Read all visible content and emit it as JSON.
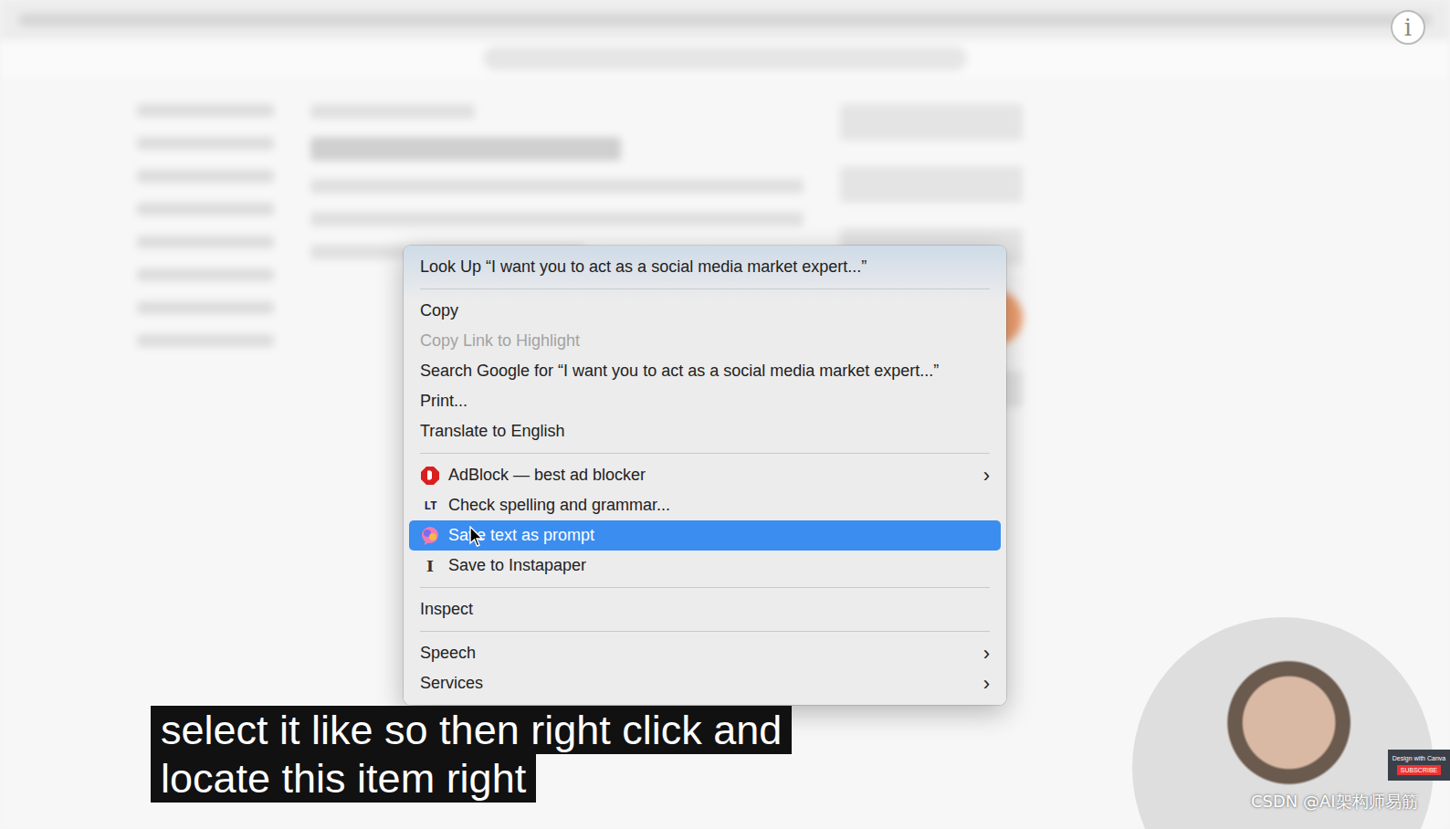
{
  "menu": {
    "groups": [
      [
        {
          "kind": "text",
          "label": "Look Up “I want you to act as a social media market expert...”",
          "selected": false,
          "disabled": false
        }
      ],
      [
        {
          "kind": "text",
          "label": "Copy",
          "selected": false,
          "disabled": false
        },
        {
          "kind": "text",
          "label": "Copy Link to Highlight",
          "selected": false,
          "disabled": true
        },
        {
          "kind": "text",
          "label": "Search Google for “I want you to act as a social media market expert...”",
          "selected": false,
          "disabled": false
        },
        {
          "kind": "text",
          "label": "Print...",
          "selected": false,
          "disabled": false
        },
        {
          "kind": "text",
          "label": "Translate to English",
          "selected": false,
          "disabled": false
        }
      ],
      [
        {
          "kind": "adblock",
          "label": "AdBlock — best ad blocker",
          "selected": false,
          "disabled": false,
          "arrow": "›"
        },
        {
          "kind": "glyph",
          "glyph": "LT",
          "label": "Check spelling and grammar...",
          "selected": false,
          "disabled": false
        },
        {
          "kind": "prompt",
          "label": "Save text as prompt",
          "selected": true,
          "disabled": false
        },
        {
          "kind": "glyph",
          "glyph": "I",
          "label": "Save to Instapaper",
          "selected": false,
          "disabled": false
        }
      ],
      [
        {
          "kind": "text",
          "label": "Inspect",
          "selected": false,
          "disabled": false
        }
      ],
      [
        {
          "kind": "text",
          "label": "Speech",
          "selected": false,
          "disabled": false,
          "arrow": "›"
        },
        {
          "kind": "text",
          "label": "Services",
          "selected": false,
          "disabled": false,
          "arrow": "›"
        }
      ]
    ]
  },
  "subtitles": [
    "select it like so then right click and",
    "locate this item right"
  ],
  "info_button": "i",
  "canva_card": {
    "text": "Design with Canva",
    "button": "SUBSCRIBE"
  },
  "watermark": "CSDN @AI架构师易筋"
}
